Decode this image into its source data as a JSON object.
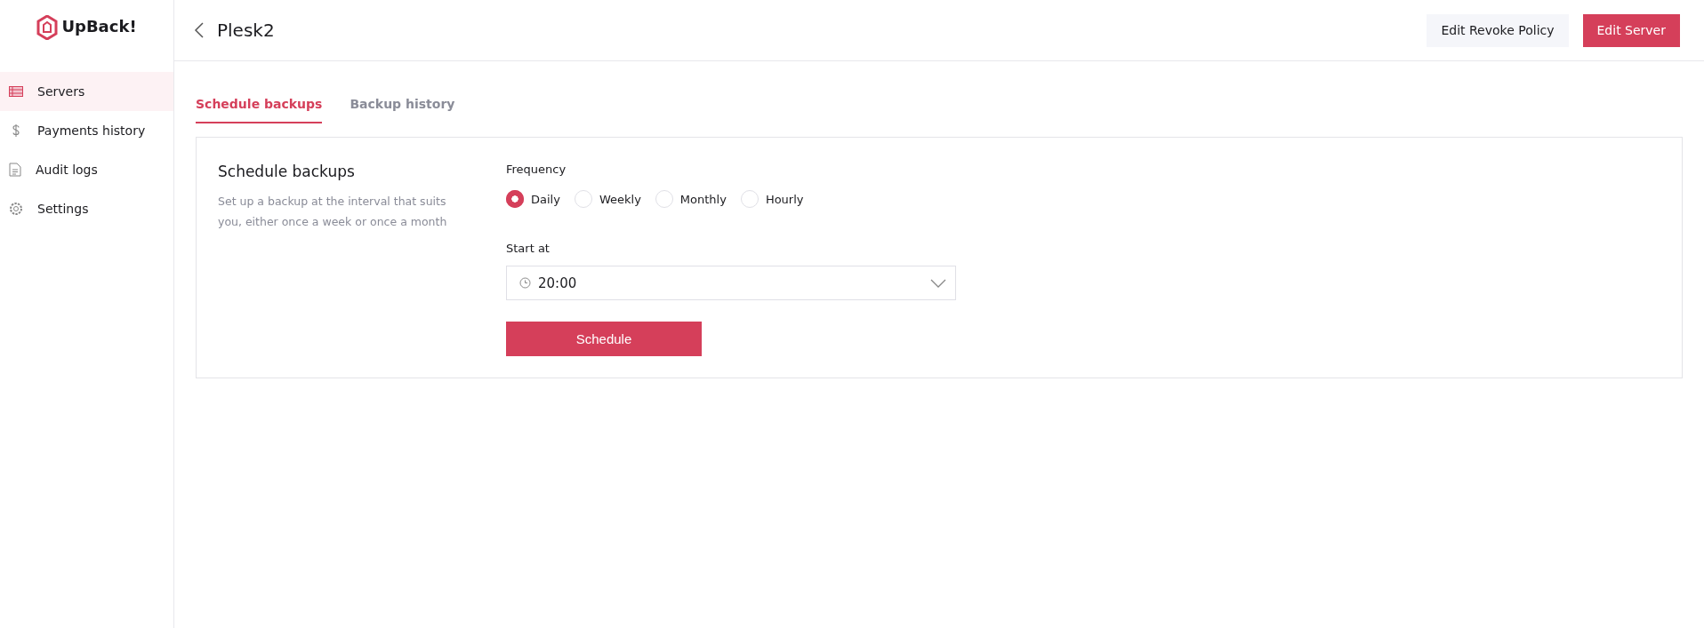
{
  "brand": {
    "name": "UpBack!"
  },
  "sidebar": {
    "items": [
      {
        "kind": "servers",
        "label": "Servers",
        "selected": true
      },
      {
        "kind": "payments",
        "label": "Payments history",
        "selected": false
      },
      {
        "kind": "audit",
        "label": "Audit logs",
        "selected": false
      },
      {
        "kind": "settings",
        "label": "Settings",
        "selected": false
      }
    ]
  },
  "header": {
    "title": "Plesk2",
    "buttons": [
      {
        "kind": "secondary",
        "label": "Edit Revoke Policy"
      },
      {
        "kind": "primary",
        "label": "Edit Server"
      }
    ]
  },
  "tabs": [
    {
      "label": "Schedule backups",
      "selected": true
    },
    {
      "label": "Backup history",
      "selected": false
    }
  ],
  "card": {
    "title": "Schedule backups",
    "description": "Set up a backup at the interval that suits you, either once a week or once a month",
    "frequency": {
      "label": "Frequency",
      "options": [
        {
          "label": "Daily",
          "selected": true
        },
        {
          "label": "Weekly",
          "selected": false
        },
        {
          "label": "Monthly",
          "selected": false
        },
        {
          "label": "Hourly",
          "selected": false
        }
      ]
    },
    "start": {
      "label": "Start at",
      "value": "20:00"
    },
    "submit": "Schedule"
  }
}
